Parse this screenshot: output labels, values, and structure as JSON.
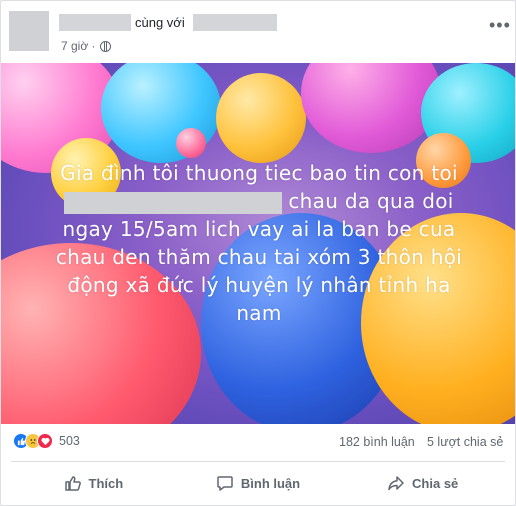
{
  "header": {
    "with_text": "cùng với",
    "time": "7 giờ ·"
  },
  "post_image": {
    "lines": [
      "Gia đình tôi thuong tiec bao tin con toi",
      "chau da qua doi",
      "ngay 15/5am lich vay ai la ban be cua",
      "chau den thăm chau tai xóm 3 thôn hội",
      "động xã đức lý huyện lý nhân tỉnh ha",
      "nam"
    ]
  },
  "stats": {
    "reaction_count": "503",
    "comments": "182 bình luận",
    "shares": "5 lượt chia sẻ"
  },
  "actions": {
    "like": "Thích",
    "comment": "Bình luận",
    "share": "Chia sẻ"
  },
  "icons": [
    "globe-icon",
    "more-icon",
    "like-reaction-icon",
    "sad-reaction-icon",
    "love-reaction-icon",
    "thumbs-up-icon",
    "comment-icon",
    "share-icon"
  ],
  "colors": {
    "like_blue": "#1877f2",
    "love_red": "#f0284a",
    "sad_yellow": "#f7c540",
    "action_gray": "#606770"
  }
}
